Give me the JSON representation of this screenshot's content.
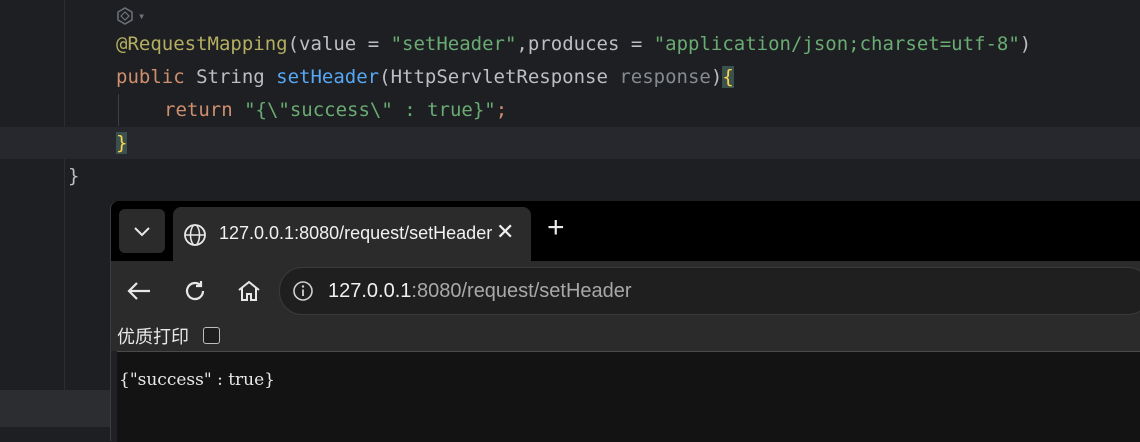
{
  "editor": {
    "line1": {
      "annotation": "@RequestMapping",
      "open": "(",
      "key1": "value",
      "eq1": " = ",
      "val1": "\"setHeader\"",
      "comma": ",",
      "key2": "produces",
      "eq2": " = ",
      "val2": "\"application/json;charset=utf-8\"",
      "close": ")"
    },
    "line2": {
      "kw": "public",
      "type": " String ",
      "method": "setHeader",
      "open": "(",
      "ptype": "HttpServletResponse ",
      "pname": "response",
      "close": ")",
      "brace": "{"
    },
    "line3": {
      "kw": "return",
      "space": " ",
      "str": "\"{\\\"success\\\" : true}\"",
      "semi": ";"
    },
    "line4": {
      "brace": "}"
    },
    "line5": {
      "brace": "}"
    }
  },
  "browser": {
    "tab_title": "127.0.0.1:8080/request/setHeader",
    "tab_close": "✕",
    "new_tab": "+",
    "url_host": "127.0.0.1",
    "url_rest": ":8080/request/setHeader",
    "pretty_print_label": "优质打印",
    "body": "{\"success\" : true}"
  },
  "colors": {
    "editor_bg": "#1e1f22",
    "keyword": "#cf8e6d",
    "string": "#6aab73",
    "annotation": "#b3ae60",
    "method": "#56a8f5"
  }
}
